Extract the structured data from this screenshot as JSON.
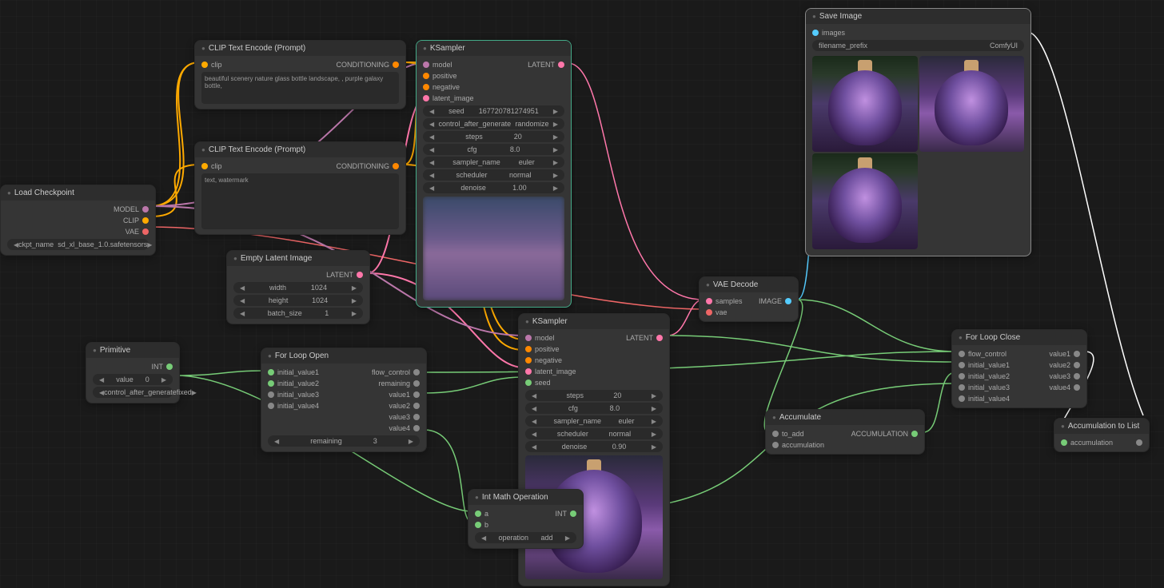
{
  "nodes": {
    "load_checkpoint": {
      "title": "Load Checkpoint",
      "out": [
        "MODEL",
        "CLIP",
        "VAE"
      ],
      "widget": {
        "label": "ckpt_name",
        "value": "sd_xl_base_1.0.safetensors"
      }
    },
    "clip1": {
      "title": "CLIP Text Encode (Prompt)",
      "in": "clip",
      "out": "CONDITIONING",
      "text": "beautiful scenery nature glass bottle landscape, , purple galaxy bottle,"
    },
    "clip2": {
      "title": "CLIP Text Encode (Prompt)",
      "in": "clip",
      "out": "CONDITIONING",
      "text": "text, watermark"
    },
    "empty_latent": {
      "title": "Empty Latent Image",
      "out": "LATENT",
      "widgets": [
        {
          "label": "width",
          "value": "1024"
        },
        {
          "label": "height",
          "value": "1024"
        },
        {
          "label": "batch_size",
          "value": "1"
        }
      ]
    },
    "ksampler1": {
      "title": "KSampler",
      "in": [
        "model",
        "positive",
        "negative",
        "latent_image"
      ],
      "out": "LATENT",
      "widgets": [
        {
          "label": "seed",
          "value": "167720781274951"
        },
        {
          "label": "control_after_generate",
          "value": "randomize"
        },
        {
          "label": "steps",
          "value": "20"
        },
        {
          "label": "cfg",
          "value": "8.0"
        },
        {
          "label": "sampler_name",
          "value": "euler"
        },
        {
          "label": "scheduler",
          "value": "normal"
        },
        {
          "label": "denoise",
          "value": "1.00"
        }
      ]
    },
    "ksampler2": {
      "title": "KSampler",
      "in": [
        "model",
        "positive",
        "negative",
        "latent_image",
        "seed"
      ],
      "out": "LATENT",
      "widgets": [
        {
          "label": "steps",
          "value": "20"
        },
        {
          "label": "cfg",
          "value": "8.0"
        },
        {
          "label": "sampler_name",
          "value": "euler"
        },
        {
          "label": "scheduler",
          "value": "normal"
        },
        {
          "label": "denoise",
          "value": "0.90"
        }
      ]
    },
    "primitive": {
      "title": "Primitive",
      "out": "INT",
      "widgets": [
        {
          "label": "value",
          "value": "0"
        },
        {
          "label": "control_after_generate",
          "value": "fixed"
        }
      ]
    },
    "forloop_open": {
      "title": "For Loop Open",
      "in": [
        "initial_value1",
        "initial_value2",
        "initial_value3",
        "initial_value4"
      ],
      "out": [
        "flow_control",
        "remaining",
        "value1",
        "value2",
        "value3",
        "value4"
      ],
      "widget": {
        "label": "remaining",
        "value": "3"
      }
    },
    "forloop_close": {
      "title": "For Loop Close",
      "in": [
        "flow_control",
        "initial_value1",
        "initial_value2",
        "initial_value3",
        "initial_value4"
      ],
      "out": [
        "value1",
        "value2",
        "value3",
        "value4"
      ]
    },
    "intmath": {
      "title": "Int Math Operation",
      "in": [
        "a",
        "b"
      ],
      "out": "INT",
      "widget": {
        "label": "operation",
        "value": "add"
      }
    },
    "vae_decode": {
      "title": "VAE Decode",
      "in": [
        "samples",
        "vae"
      ],
      "out": "IMAGE"
    },
    "accumulate": {
      "title": "Accumulate",
      "in": [
        "to_add",
        "accumulation"
      ],
      "out": "ACCUMULATION"
    },
    "acc_to_list": {
      "title": "Accumulation to List",
      "in": "accumulation"
    },
    "save_image": {
      "title": "Save Image",
      "in": "images",
      "widget": {
        "label": "filename_prefix",
        "value": "ComfyUI"
      }
    }
  }
}
